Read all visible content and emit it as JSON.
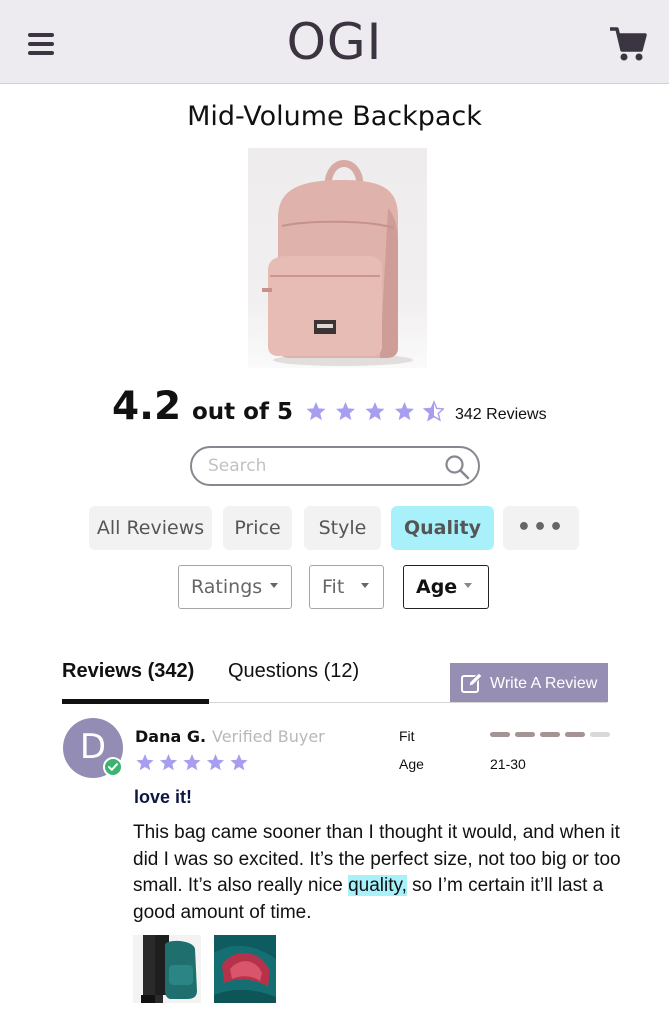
{
  "header": {
    "logo": "OGI"
  },
  "product": {
    "title": "Mid-Volume Backpack"
  },
  "rating": {
    "score": "4.2",
    "out_of": "out of 5",
    "stars_value": 4.5,
    "stars_max": 5,
    "reviews_count": "342 Reviews",
    "star_color": "#a79ef0"
  },
  "search": {
    "placeholder": "Search"
  },
  "filters": {
    "items": [
      {
        "label": "All Reviews"
      },
      {
        "label": "Price"
      },
      {
        "label": "Style"
      },
      {
        "label": "Quality"
      },
      {
        "label": "•••"
      }
    ],
    "active": "Quality",
    "active_color": "#a8f1fb"
  },
  "dropdowns": {
    "items": [
      {
        "label": "Ratings"
      },
      {
        "label": "Fit"
      },
      {
        "label": "Age"
      }
    ],
    "active": "Age"
  },
  "tabs": {
    "items": [
      {
        "label": "Reviews (342)"
      },
      {
        "label": "Questions (12)"
      }
    ],
    "active": "Reviews (342)"
  },
  "write_review": {
    "label": "Write A Review",
    "color": "#968fb3"
  },
  "review": {
    "avatar_initial": "D",
    "avatar_color": "#938cb5",
    "name": "Dana G.",
    "badge": "Verified Buyer",
    "stars_value": 5,
    "fit_label": "Fit",
    "fit_value": 4,
    "fit_max": 5,
    "age_label": "Age",
    "age_value": "21-30",
    "title": "love it!",
    "body_before": "This bag came sooner than I thought it would, and when it did I was so excited. It’s the perfect size, not too big or too small. It’s also really nice ",
    "body_highlight": "quality,",
    "body_after": " so I’m certain it’ll last a good amount of time.",
    "photos_count": 2
  }
}
